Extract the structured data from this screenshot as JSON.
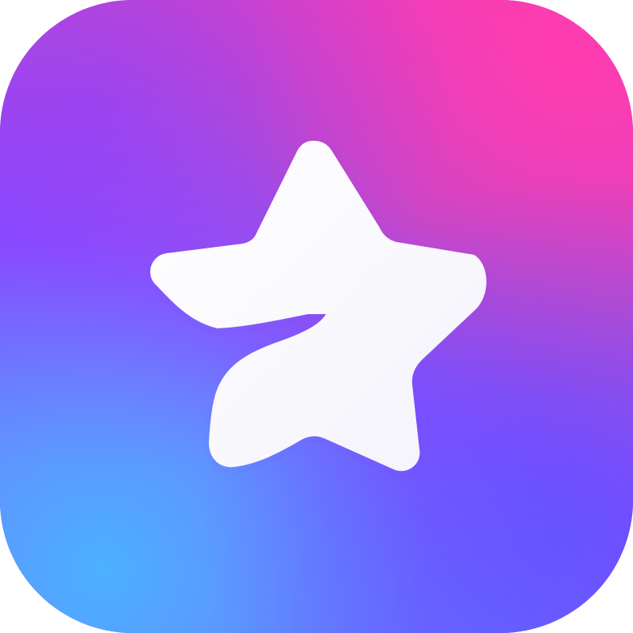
{
  "icon": {
    "name": "star-icon",
    "background_colors": [
      "#ff36a8",
      "#8d42ff",
      "#5f74ff",
      "#4bb2ff"
    ],
    "foreground_color": "#ffffff"
  }
}
